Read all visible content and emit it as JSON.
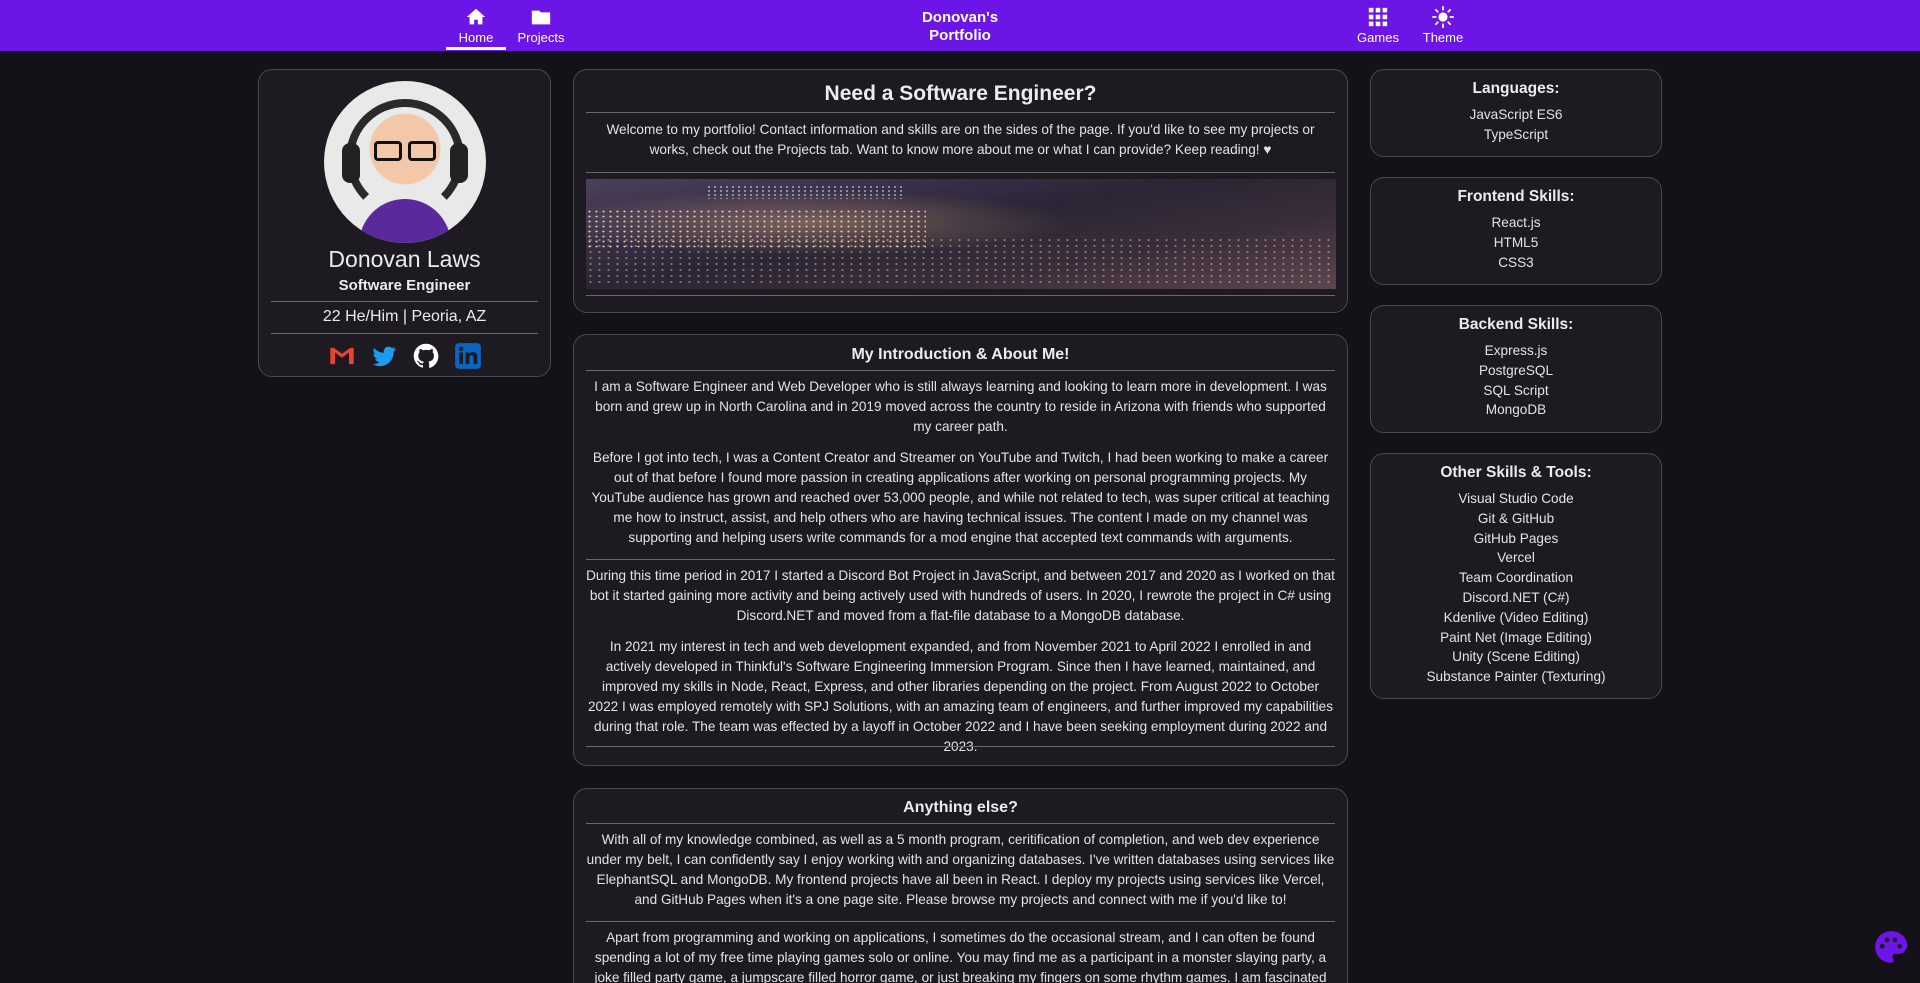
{
  "nav": {
    "home_label": "Home",
    "projects_label": "Projects",
    "brand_line1": "Donovan's",
    "brand_line2": "Portfolio",
    "games_label": "Games",
    "theme_label": "Theme"
  },
  "profile": {
    "name": "Donovan Laws",
    "role": "Software Engineer",
    "meta": "22 He/Him | Peoria, AZ",
    "socials": [
      "gmail-icon",
      "twitter-icon",
      "github-icon",
      "linkedin-icon"
    ]
  },
  "intro_card": {
    "title": "Need a Software Engineer?",
    "text": "Welcome to my portfolio! Contact information and skills are on the sides of the page. If you'd like to see my projects or works, check out the Projects tab. Want to know more about me or what I can provide? Keep reading! ♥"
  },
  "about_card": {
    "title": "My Introduction & About Me!",
    "p1": "I am a Software Engineer and Web Developer who is still always learning and looking to learn more in development. I was born and grew up in North Carolina and in 2019 moved across the country to reside in Arizona with friends who supported my career path.",
    "p2": "Before I got into tech, I was a Content Creator and Streamer on YouTube and Twitch, I had been working to make a career out of that before I found more passion in creating applications after working on personal programming projects. My YouTube audience has grown and reached over 53,000 people, and while not related to tech, was super critical at teaching me how to instruct, assist, and help others who are having technical issues. The content I made on my channel was supporting and helping users write commands for a mod engine that accepted text commands with arguments.",
    "p3": "During this time period in 2017 I started a Discord Bot Project in JavaScript, and between 2017 and 2020 as I worked on that bot it started gaining more activity and being actively used with hundreds of users. In 2020, I rewrote the project in C# using Discord.NET and moved from a flat-file database to a MongoDB database.",
    "p4": "In 2021 my interest in tech and web development expanded, and from November 2021 to April 2022 I enrolled in and actively developed in Thinkful's Software Engineering Immersion Program. Since then I have learned, maintained, and improved my skills in Node, React, Express, and other libraries depending on the project. From August 2022 to October 2022 I was employed remotely with SPJ Solutions, with an amazing team of engineers, and further improved my capabilities during that role. The team was effected by a layoff in October 2022 and I have been seeking employment during 2022 and 2023."
  },
  "else_card": {
    "title": "Anything else?",
    "p1": "With all of my knowledge combined, as well as a 5 month program, ceritification of completion, and web dev experience under my belt, I can confidently say I enjoy working with and organizing databases. I've written databases using services like ElephantSQL and MongoDB. My frontend projects have all been in React. I deploy my projects using services like Vercel, and GitHub Pages when it's a one page site. Please browse my projects and connect with me if you'd like to!",
    "p2": "Apart from programming and working on applications, I sometimes do the occasional stream, and I can often be found spending a lot of my free time playing games solo or online. You may find me as a participant in a monster slaying party, a joke filled party game, a jumpscare filled horror game, or just breaking my fingers on some rhythm games. I am fascinated by"
  },
  "skills": {
    "languages": {
      "title": "Languages:",
      "items": [
        "JavaScript ES6",
        "TypeScript"
      ]
    },
    "frontend": {
      "title": "Frontend Skills:",
      "items": [
        "React.js",
        "HTML5",
        "CSS3"
      ]
    },
    "backend": {
      "title": "Backend Skills:",
      "items": [
        "Express.js",
        "PostgreSQL",
        "SQL Script",
        "MongoDB"
      ]
    },
    "other": {
      "title": "Other Skills & Tools:",
      "items": [
        "Visual Studio Code",
        "Git & GitHub",
        "GitHub Pages",
        "Vercel",
        "Team Coordination",
        "Discord.NET (C#)",
        "Kdenlive (Video Editing)",
        "Paint Net (Image Editing)",
        "Unity (Scene Editing)",
        "Substance Painter (Texturing)"
      ]
    }
  },
  "colors": {
    "nav_bg": "#6b16e6",
    "page_bg": "#141218",
    "card_bg": "#1d1b21",
    "palette_button": "#6b16e6"
  }
}
